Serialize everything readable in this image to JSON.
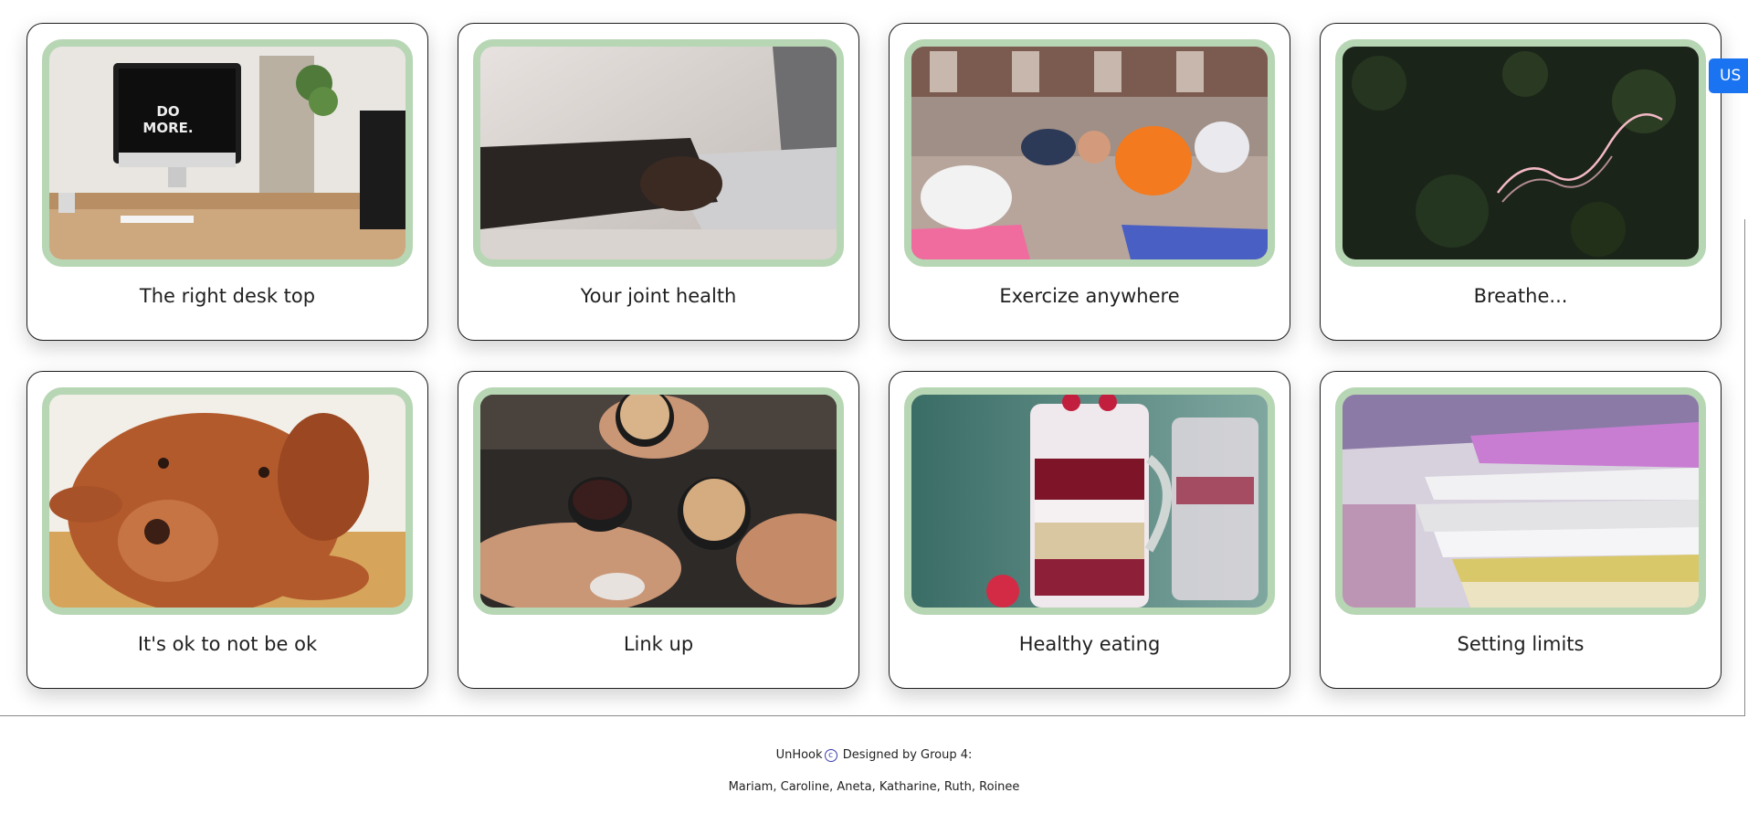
{
  "cards": [
    {
      "title": "The right desk top",
      "image": "desk-computer-photo"
    },
    {
      "title": "Your joint health",
      "image": "hand-writing-laptop-photo"
    },
    {
      "title": "Exercize anywhere",
      "image": "yoga-class-photo"
    },
    {
      "title": "Breathe...",
      "image": "breathe-neon-sign-photo"
    },
    {
      "title": "It's ok to not be ok",
      "image": "resting-dog-photo"
    },
    {
      "title": "Link up",
      "image": "coffee-cheers-photo"
    },
    {
      "title": "Healthy eating",
      "image": "yogurt-parfait-photo"
    },
    {
      "title": "Setting limits",
      "image": "paper-stack-photo"
    }
  ],
  "footer": {
    "brand": "UnHook",
    "copyright_symbol": "c",
    "designed_by": "Designed by Group 4:",
    "members": "Mariam, Caroline, Aneta, Katharine, Ruth, Roinee"
  },
  "language_button": "US",
  "colors": {
    "card_image_border": "#b7d6b4",
    "language_button": "#1a73f0"
  }
}
